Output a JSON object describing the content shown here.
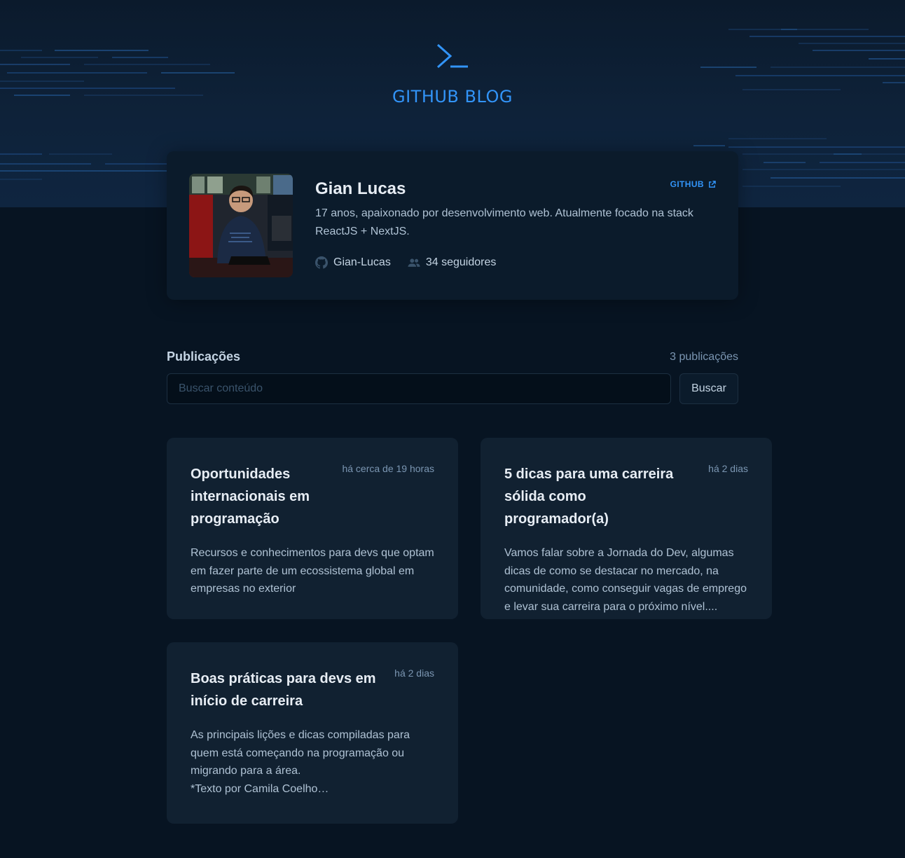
{
  "header": {
    "title": "GITHUB BLOG",
    "logo_icon": "terminal-prompt-icon",
    "accent_color": "#3294f8"
  },
  "profile": {
    "name": "Gian Lucas",
    "github_link_label": "GITHUB",
    "github_link_icon": "external-link-icon",
    "bio": "17 anos, apaixonado por desenvolvimento web. Atualmente focado na stack ReactJS + NextJS.",
    "username": "Gian-Lucas",
    "username_icon": "github-icon",
    "followers": "34 seguidores",
    "followers_icon": "users-icon"
  },
  "publications": {
    "title": "Publicações",
    "count": "3 publicações",
    "search_placeholder": "Buscar conteúdo",
    "search_value": "",
    "search_button": "Buscar"
  },
  "posts": [
    {
      "title": "Oportunidades internacionais em programação",
      "date": "há cerca de 19 horas",
      "excerpt": "Recursos e conhecimentos para devs que optam em fazer parte de um ecossistema global em empresas no exterior"
    },
    {
      "title": "5 dicas para uma carreira sólida como programador(a)",
      "date": "há 2 dias",
      "excerpt": "Vamos falar sobre a Jornada do Dev, algumas dicas de como se destacar no mercado, na comunidade, como conseguir vagas de emprego e levar sua carreira para o próximo nível...."
    },
    {
      "title": "Boas práticas para devs em início de carreira",
      "date": "há 2 dias",
      "excerpt": "As principais lições e dicas compiladas para quem está começando na programação ou migrando para a área.\n*Texto por Camila Coelho…"
    }
  ]
}
